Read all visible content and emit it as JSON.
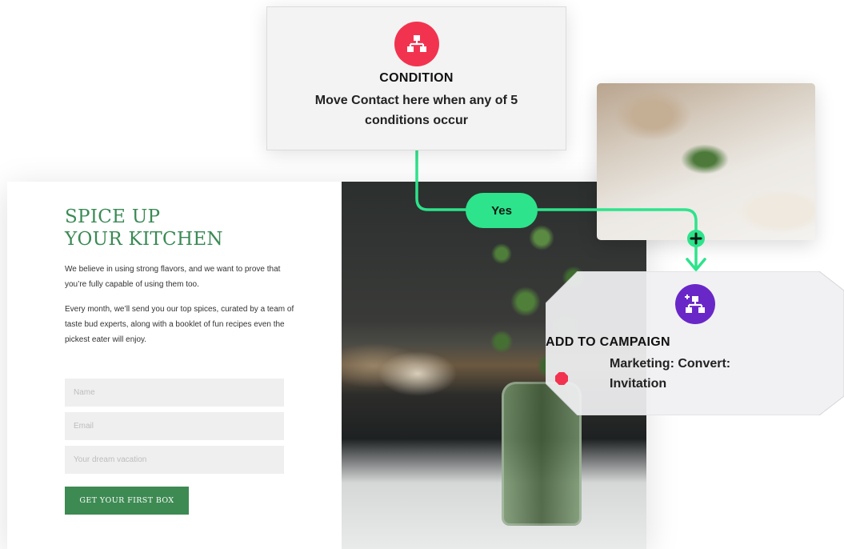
{
  "landing": {
    "title_line1": "SPICE UP",
    "title_line2": "YOUR KITCHEN",
    "paragraph1": "We believe in using strong flavors, and we want to prove that you’re fully capable of using them too.",
    "paragraph2": "Every month, we’ll send you our top spices, curated by a team of taste bud experts, along with a booklet of fun recipes even the pickest eater will enjoy.",
    "form": {
      "name_placeholder": "Name",
      "email_placeholder": "Email",
      "vacation_placeholder": "Your dream vacation",
      "submit_label": "GET YOUR FIRST BOX"
    }
  },
  "flow": {
    "condition": {
      "icon": "hierarchy-icon",
      "icon_color": "#f2334f",
      "title": "CONDITION",
      "description": "Move Contact here when any of 5 conditions occur"
    },
    "branch_label": "Yes",
    "connector_color": "#2de38b",
    "add_icon": "plus-icon",
    "campaign": {
      "icon": "hierarchy-plus-icon",
      "icon_color": "#6a27c8",
      "title": "ADD TO CAMPAIGN",
      "description": "Marketing: Convert: Invitation"
    }
  },
  "colors": {
    "brand_green": "#3d8a52",
    "accent_green": "#2de38b",
    "condition_red": "#f2334f",
    "campaign_purple": "#6a27c8"
  }
}
